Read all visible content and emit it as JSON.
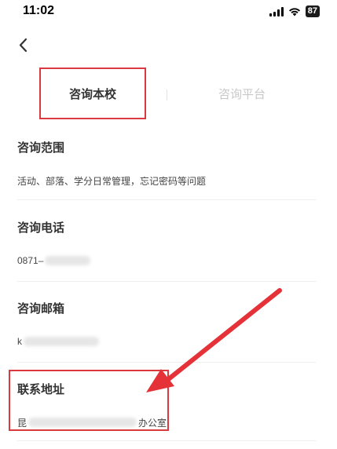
{
  "status_bar": {
    "time": "11:02",
    "battery": "87"
  },
  "tabs": [
    {
      "label": "咨询本校"
    },
    {
      "label": "咨询平台"
    }
  ],
  "sections": [
    {
      "title": "咨询范围",
      "value": "活动、部落、学分日常管理，忘记密码等问题"
    },
    {
      "title": "咨询电话",
      "value": "0871–"
    },
    {
      "title": "咨询邮箱",
      "value": "k"
    },
    {
      "title": "联系地址",
      "value_prefix": "昆",
      "value_suffix": "办公室"
    }
  ],
  "colors": {
    "highlight": "#d9393f",
    "arrow": "#e53238"
  }
}
